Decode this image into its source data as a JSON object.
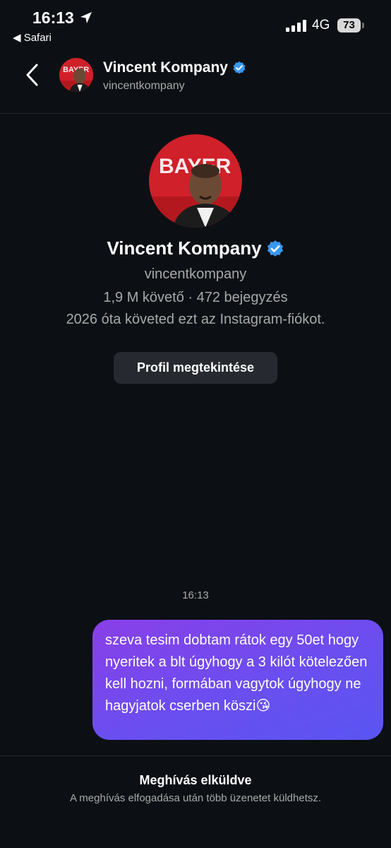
{
  "status_bar": {
    "time": "16:13",
    "back_app": "◀ Safari",
    "network": "4G",
    "battery": "73"
  },
  "header": {
    "name": "Vincent Kompany",
    "username": "vincentkompany"
  },
  "profile": {
    "name": "Vincent Kompany",
    "username": "vincentkompany",
    "stats": "1,9 M követő · 472 bejegyzés",
    "since": "2026 óta követed ezt az Instagram-fiókot.",
    "view_button": "Profil megtekintése",
    "avatar_banner": "BAYER"
  },
  "conversation": {
    "time": "16:13",
    "message": "szeva tesim dobtam rátok egy 50et hogy nyeritek a blt úgyhogy a 3 kilót kötelezően kell hozni, formában vagytok úgyhogy ne hagyjatok cserben köszi😘"
  },
  "footer": {
    "title": "Meghívás elküldve",
    "text": "A meghívás elfogadása után több üzenetet küldhetsz."
  },
  "colors": {
    "background": "#0c1014",
    "verified": "#3897f0",
    "bubble_start": "#8a3fe8",
    "bubble_end": "#5a55f2",
    "avatar_bg": "#d0202a"
  }
}
